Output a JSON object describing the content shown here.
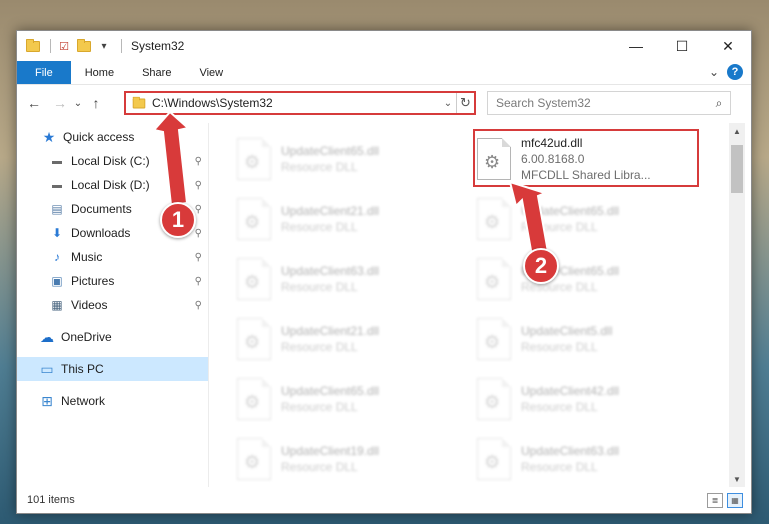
{
  "window": {
    "title": "System32",
    "controls": {
      "minimize": "—",
      "maximize": "☐",
      "close": "✕"
    }
  },
  "ribbon": {
    "tabs": [
      {
        "label": "File"
      },
      {
        "label": "Home"
      },
      {
        "label": "Share"
      },
      {
        "label": "View"
      }
    ],
    "expand_glyph": "⌄",
    "help_glyph": "?"
  },
  "nav": {
    "back_glyph": "←",
    "forward_glyph": "→",
    "recent_glyph": "⌄",
    "up_glyph": "↑",
    "address": "C:\\Windows\\System32",
    "address_drop_glyph": "⌄",
    "refresh_glyph": "↻",
    "search_placeholder": "Search System32",
    "search_glyph": "⌕"
  },
  "sidebar": {
    "items": [
      {
        "label": "Quick access",
        "icon": "star-icon",
        "glyph": "★"
      },
      {
        "label": "Local Disk (C:)",
        "icon": "drive-icon",
        "glyph": "▬"
      },
      {
        "label": "Local Disk (D:)",
        "icon": "drive-icon",
        "glyph": "▬"
      },
      {
        "label": "Documents",
        "icon": "documents-icon",
        "glyph": "▤"
      },
      {
        "label": "Downloads",
        "icon": "download-icon",
        "glyph": "⬇"
      },
      {
        "label": "Music",
        "icon": "music-icon",
        "glyph": "♪"
      },
      {
        "label": "Pictures",
        "icon": "pictures-icon",
        "glyph": "▣"
      },
      {
        "label": "Videos",
        "icon": "videos-icon",
        "glyph": "▦"
      },
      {
        "label": "OneDrive",
        "icon": "cloud-icon",
        "glyph": "☁"
      },
      {
        "label": "This PC",
        "icon": "computer-icon",
        "glyph": "▭"
      },
      {
        "label": "Network",
        "icon": "network-icon",
        "glyph": "⊞"
      }
    ],
    "pin_glyph": "📌"
  },
  "files": {
    "left_column": [
      {
        "name": "UpdateClient65.dll",
        "type": "Resource DLL"
      },
      {
        "name": "UpdateClient21.dll",
        "type": "Resource DLL"
      },
      {
        "name": "UpdateClient63.dll",
        "type": "Resource DLL"
      },
      {
        "name": "UpdateClient21.dll",
        "type": "Resource DLL"
      },
      {
        "name": "UpdateClient65.dll",
        "type": "Resource DLL"
      },
      {
        "name": "UpdateClient19.dll",
        "type": "Resource DLL"
      }
    ],
    "right_column": [
      {
        "name": "mfc42ud.dll",
        "version": "6.00.8168.0",
        "type": "MFCDLL Shared Libra..."
      },
      {
        "name": "UpdateClient65.dll",
        "type": "Resource DLL"
      },
      {
        "name": "UpdateClient65.dll",
        "type": "Resource DLL"
      },
      {
        "name": "UpdateClient5.dll",
        "type": "Resource DLL"
      },
      {
        "name": "UpdateClient42.dll",
        "type": "Resource DLL"
      },
      {
        "name": "UpdateClient63.dll",
        "type": "Resource DLL"
      }
    ],
    "gear_glyph": "⚙"
  },
  "status": {
    "count": "101 items",
    "details_glyph": "≣",
    "tiles_glyph": "▦"
  },
  "annotations": {
    "step1": "1",
    "step2": "2",
    "accent": "#d83a3a"
  }
}
